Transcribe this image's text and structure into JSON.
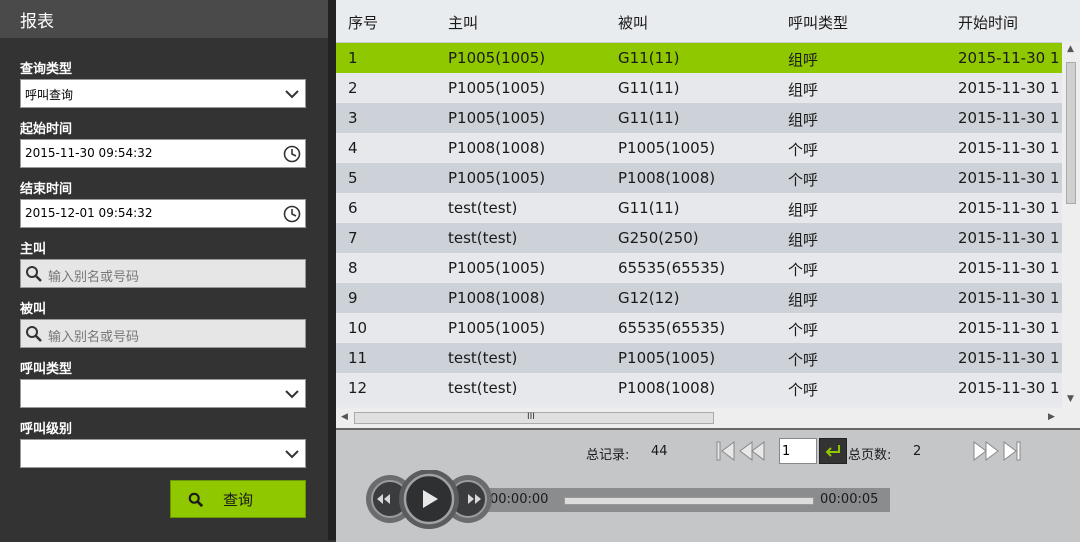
{
  "sidebar": {
    "title": "报表",
    "query_type_label": "查询类型",
    "query_type_value": "呼叫查询",
    "start_time_label": "起始时间",
    "start_time_value": "2015-11-30 09:54:32",
    "end_time_label": "结束时间",
    "end_time_value": "2015-12-01 09:54:32",
    "caller_label": "主叫",
    "caller_placeholder": "输入别名或号码",
    "callee_label": "被叫",
    "callee_placeholder": "输入别名或号码",
    "call_type_label": "呼叫类型",
    "call_type_value": "",
    "call_level_label": "呼叫级别",
    "call_level_value": "",
    "query_button": "查询"
  },
  "table": {
    "columns": [
      "序号",
      "主叫",
      "被叫",
      "呼叫类型",
      "开始时间"
    ],
    "rows": [
      [
        "1",
        "P1005(1005)",
        "G11(11)",
        "组呼",
        "2015-11-30 1"
      ],
      [
        "2",
        "P1005(1005)",
        "G11(11)",
        "组呼",
        "2015-11-30 1"
      ],
      [
        "3",
        "P1005(1005)",
        "G11(11)",
        "组呼",
        "2015-11-30 1"
      ],
      [
        "4",
        "P1008(1008)",
        "P1005(1005)",
        "个呼",
        "2015-11-30 1"
      ],
      [
        "5",
        "P1005(1005)",
        "P1008(1008)",
        "个呼",
        "2015-11-30 1"
      ],
      [
        "6",
        "test(test)",
        "G11(11)",
        "组呼",
        "2015-11-30 1"
      ],
      [
        "7",
        "test(test)",
        "G250(250)",
        "组呼",
        "2015-11-30 1"
      ],
      [
        "8",
        "P1005(1005)",
        "65535(65535)",
        "个呼",
        "2015-11-30 1"
      ],
      [
        "9",
        "P1008(1008)",
        "G12(12)",
        "组呼",
        "2015-11-30 1"
      ],
      [
        "10",
        "P1005(1005)",
        "65535(65535)",
        "个呼",
        "2015-11-30 1"
      ],
      [
        "11",
        "test(test)",
        "P1005(1005)",
        "个呼",
        "2015-11-30 1"
      ],
      [
        "12",
        "test(test)",
        "P1008(1008)",
        "个呼",
        "2015-11-30 1"
      ]
    ],
    "selected_row": 1,
    "hscroll_grip": "III"
  },
  "pagination": {
    "total_records_label": "总记录:",
    "total_records": "44",
    "current_page": "1",
    "total_pages_label": "总页数:",
    "total_pages": "2"
  },
  "player": {
    "current_time": "00:00:00",
    "total_time": "00:00:05",
    "progress": 0
  },
  "colors": {
    "selected_row": "#90c800",
    "row_odd": "#e6e8eb",
    "row_even": "#cdd2d9",
    "accent": "#90c800"
  }
}
